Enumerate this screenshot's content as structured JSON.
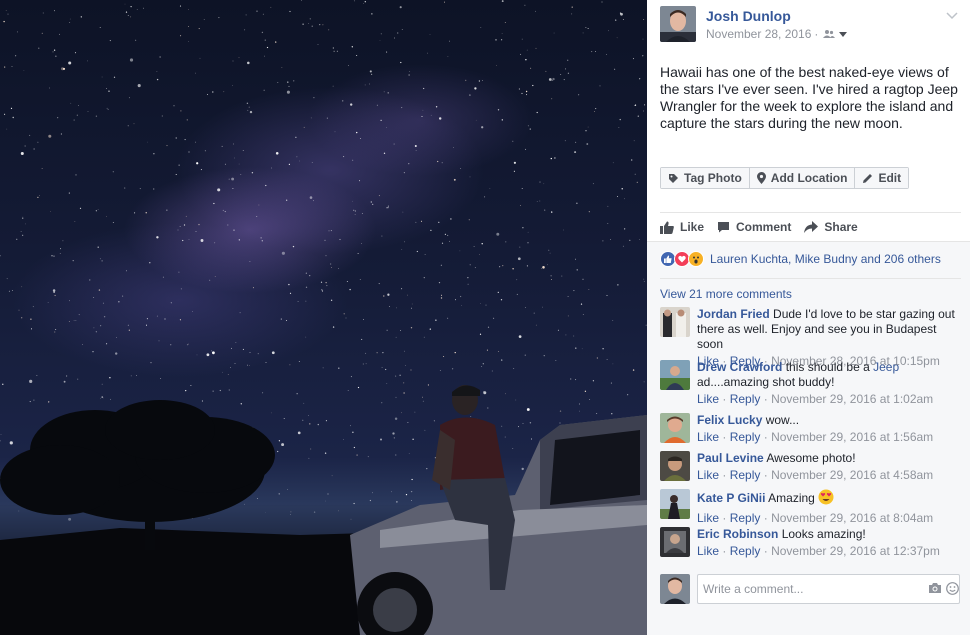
{
  "post": {
    "author": "Josh Dunlop",
    "date": "November 28, 2016",
    "separator": "·",
    "text": "Hawaii has one of the best naked-eye views of the stars I've ever seen. I've hired a ragtop Jeep Wrangler for the week to explore the island and capture the stars during the new moon."
  },
  "photo_actions": {
    "tag": "Tag Photo",
    "location": "Add Location",
    "edit": "Edit"
  },
  "ufi": {
    "like": "Like",
    "comment": "Comment",
    "share": "Share"
  },
  "reactions": {
    "text": "Lauren Kuchta, Mike Budny and 206 others",
    "types": [
      "like",
      "love",
      "wow"
    ]
  },
  "view_more": "View 21 more comments",
  "comment_labels": {
    "like": "Like",
    "reply": "Reply",
    "dot": "·"
  },
  "comments": [
    {
      "name": "Jordan Fried",
      "text": "Dude I'd love to be star gazing out there as well. Enjoy and see you in Budapest soon",
      "time": "November 28, 2016 at 10:15pm"
    },
    {
      "name": "Drew Crawford",
      "text": "this should be a",
      "mention": "Jeep",
      "text2": "ad....amazing shot buddy!",
      "time": "November 29, 2016 at 1:02am"
    },
    {
      "name": "Felix Lucky",
      "text": "wow...",
      "time": "November 29, 2016 at 1:56am"
    },
    {
      "name": "Paul Levine",
      "text": "Awesome photo!",
      "time": "November 29, 2016 at 4:58am"
    },
    {
      "name": "Kate P GiNii",
      "text": "Amazing",
      "emoji": "heart-eyes",
      "time": "November 29, 2016 at 8:04am"
    },
    {
      "name": "Eric Robinson",
      "text": "Looks amazing!",
      "time": "November 29, 2016 at 12:37pm"
    }
  ],
  "composer": {
    "placeholder": "Write a comment..."
  },
  "colors": {
    "link": "#365899",
    "muted": "#90949c",
    "panel_bg": "#f6f7f9"
  }
}
